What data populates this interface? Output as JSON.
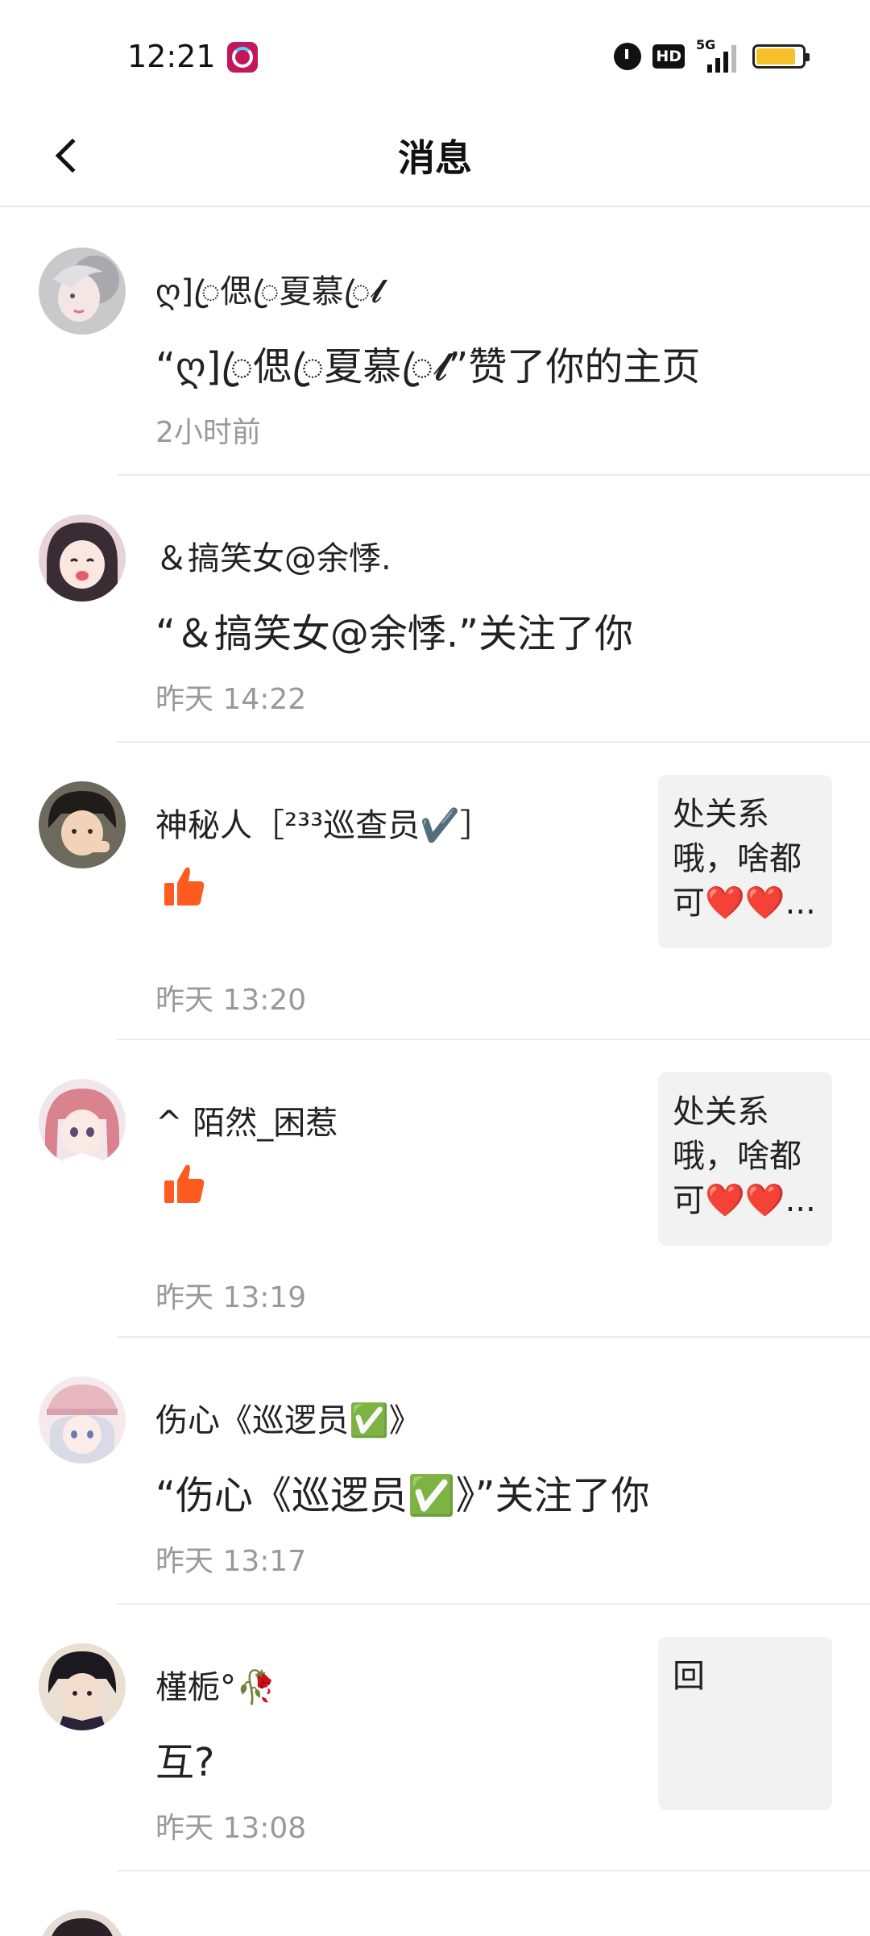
{
  "status_bar": {
    "time": "12:21",
    "network_tag": "5G",
    "hd_label": "HD",
    "icons": [
      "tiktok-lite-app-icon",
      "alarm-icon",
      "hd-icon",
      "signal-icon",
      "battery-icon"
    ],
    "battery_level": 0.85,
    "battery_color": "#f5c02a"
  },
  "header": {
    "title": "消息",
    "back_icon": "chevron-left-icon"
  },
  "messages": [
    {
      "name": "ღ]ꦿ偲ꦿ夏慕ꦿ𝓵",
      "text": "“ღ]ꦿ偲ꦿ夏慕ꦿ𝓵”赞了你的主页",
      "time": "2小时前",
      "type": "text"
    },
    {
      "name": "＆搞笑女@余悸.",
      "text": "“＆搞笑女@余悸.”关注了你",
      "time": "昨天 14:22",
      "type": "text"
    },
    {
      "name": "神秘人［²³³巡查员✔️］",
      "time": "昨天 13:20",
      "type": "like",
      "icon": "thumbs-up-icon",
      "preview_line1": "处关系",
      "preview_line2": "哦，啥都",
      "preview_line3": "可❤️❤️..."
    },
    {
      "name": "^ 陌然_困惹",
      "time": "昨天 13:19",
      "type": "like",
      "icon": "thumbs-up-icon",
      "preview_line1": "处关系",
      "preview_line2": "哦，啥都",
      "preview_line3": "可❤️❤️..."
    },
    {
      "name": "伤心《巡逻员✅》",
      "text": "“伤心《巡逻员✅》”关注了你",
      "time": "昨天 13:17",
      "type": "text"
    },
    {
      "name": "槿栀°🥀",
      "text": "互?",
      "time": "昨天 13:08",
      "type": "comment",
      "preview_line1": "回"
    }
  ],
  "colors": {
    "like_orange": "#ff5a1f",
    "timestamp_gray": "#999999",
    "preview_bg": "#f2f2f2"
  }
}
